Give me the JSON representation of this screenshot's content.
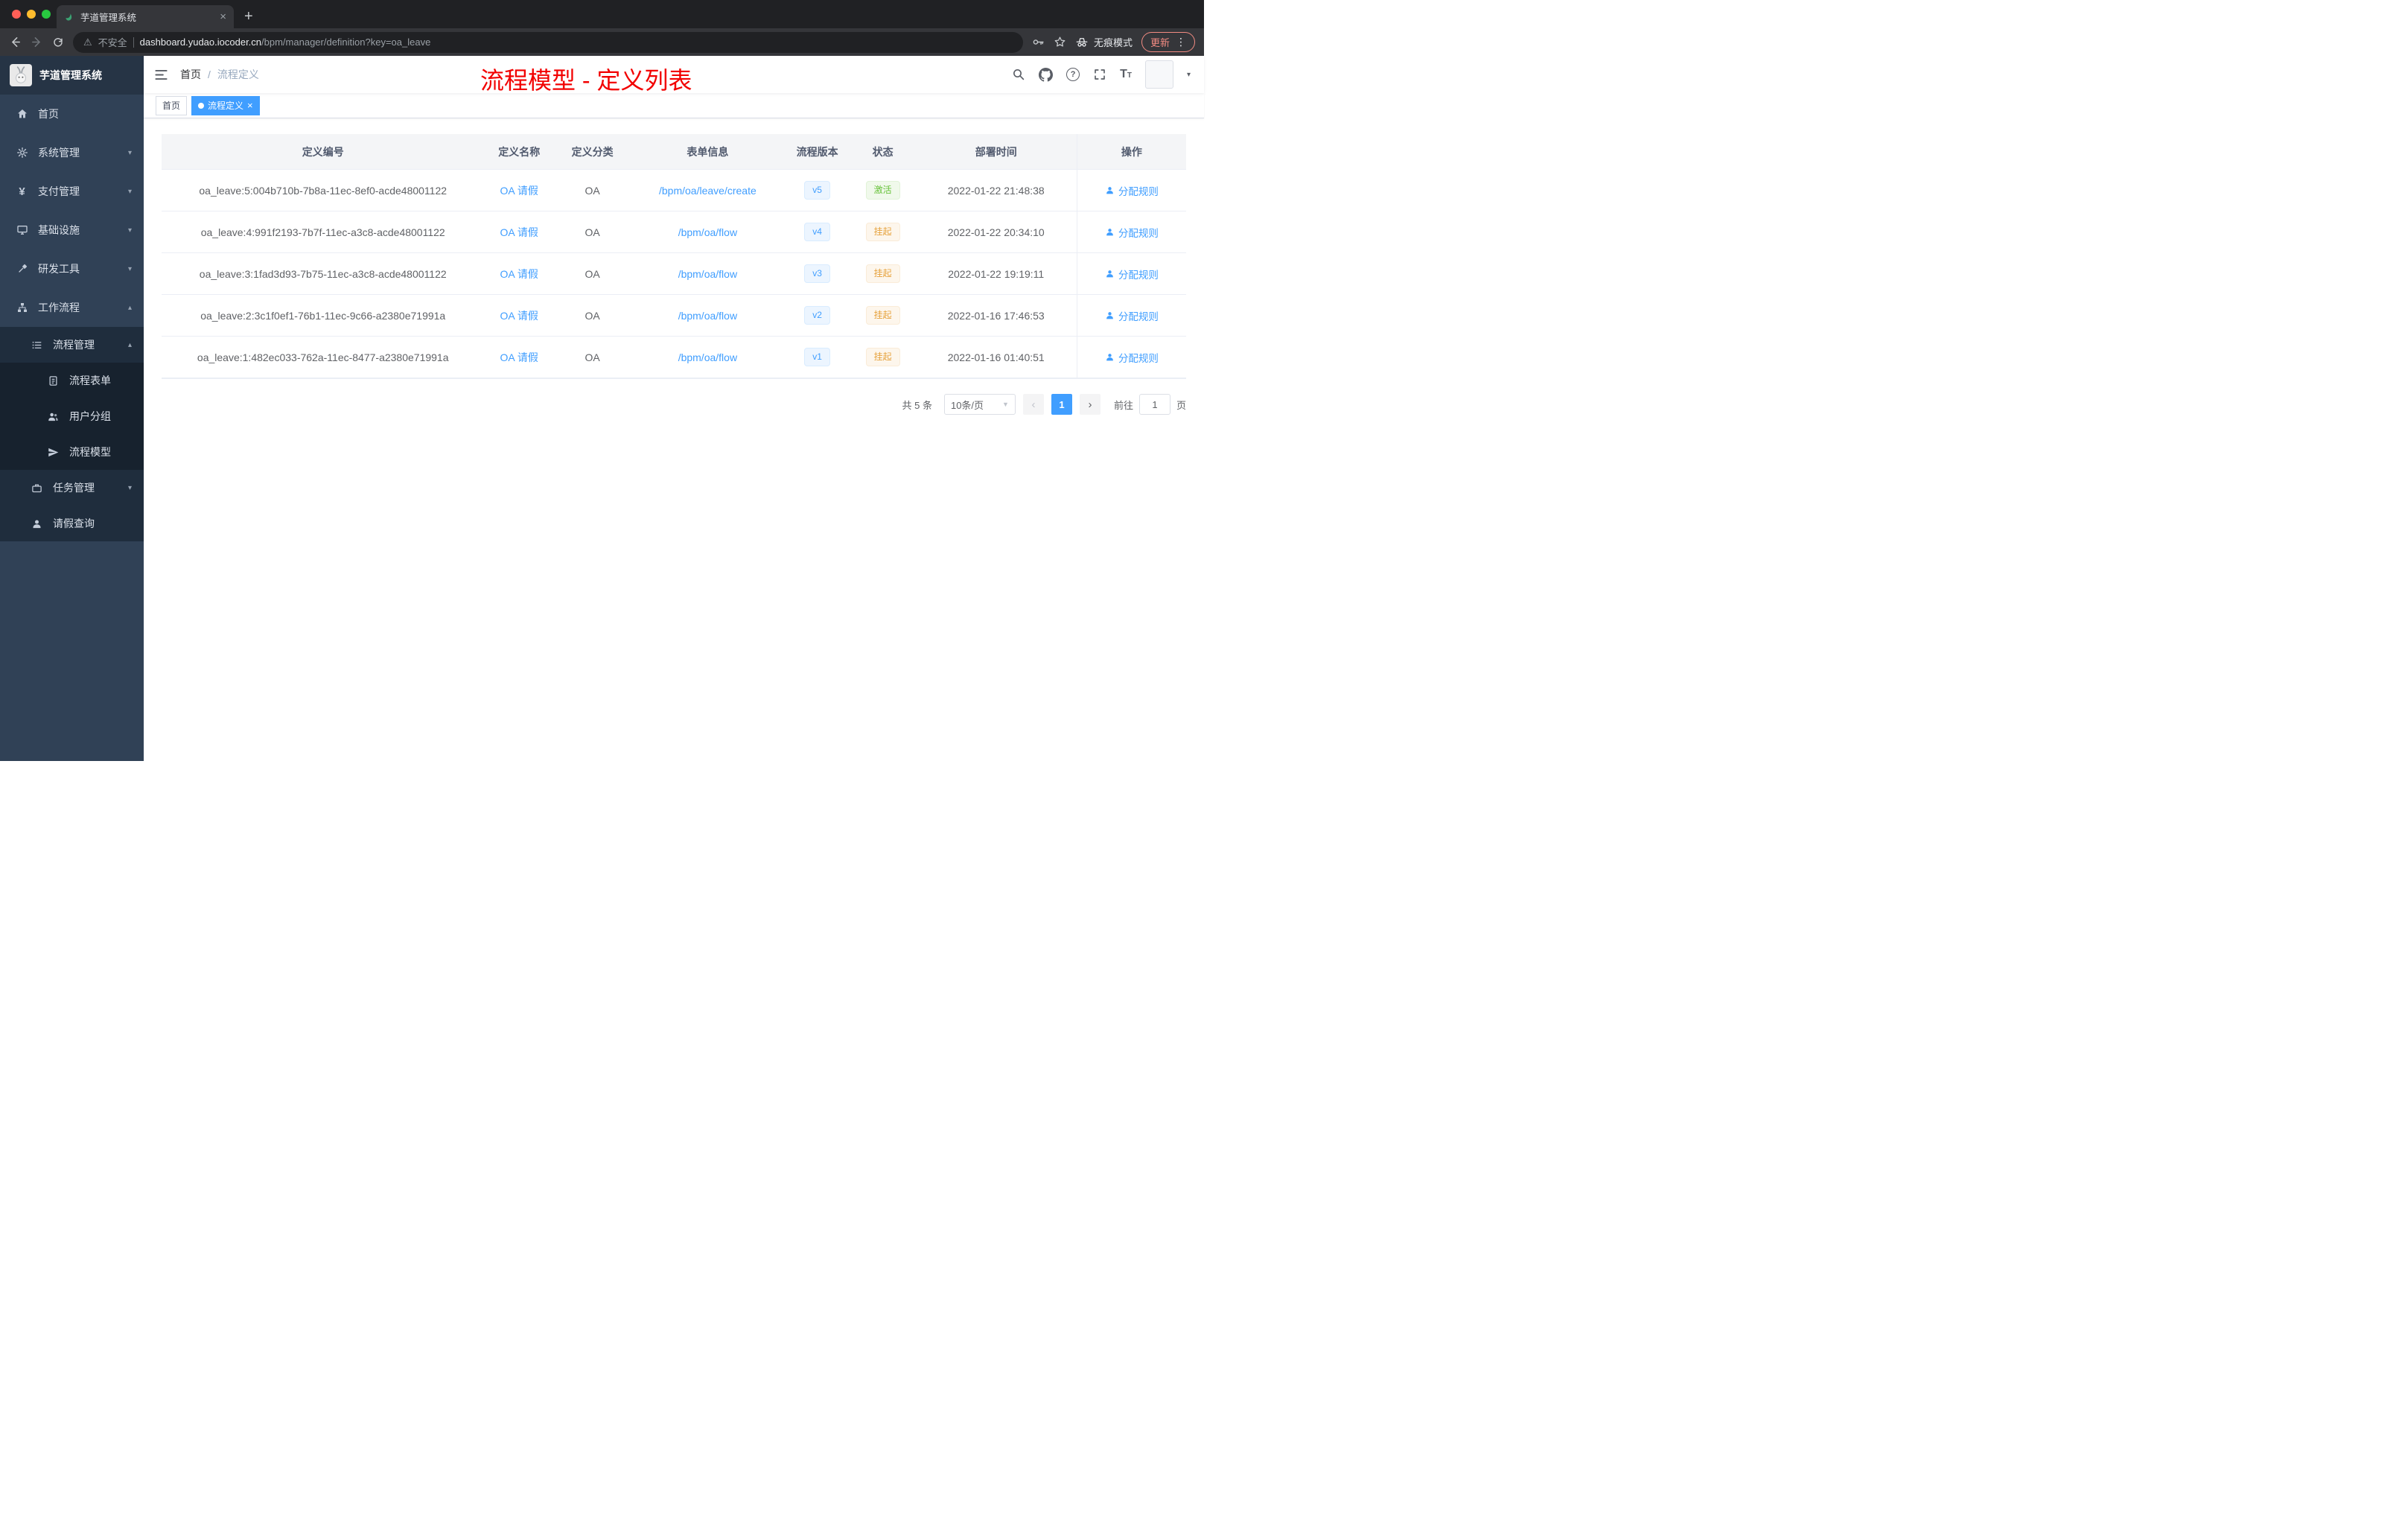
{
  "browser": {
    "tab_title": "芋道管理系统",
    "security": "不安全",
    "url_host": "dashboard.yudao.iocoder.cn",
    "url_path": "/bpm/manager/definition?key=oa_leave",
    "incognito": "无痕模式",
    "update": "更新"
  },
  "sidebar": {
    "brand": "芋道管理系统",
    "items": [
      {
        "label": "首页"
      },
      {
        "label": "系统管理"
      },
      {
        "label": "支付管理"
      },
      {
        "label": "基础设施"
      },
      {
        "label": "研发工具"
      },
      {
        "label": "工作流程"
      }
    ],
    "submenu": {
      "process_mgmt": "流程管理",
      "process_children": [
        {
          "label": "流程表单"
        },
        {
          "label": "用户分组"
        },
        {
          "label": "流程模型"
        }
      ],
      "task_mgmt": "任务管理",
      "leave_query": "请假查询"
    }
  },
  "header": {
    "breadcrumb_home": "首页",
    "breadcrumb_sep": "/",
    "breadcrumb_current": "流程定义",
    "annotation": "流程模型 - 定义列表"
  },
  "tags": {
    "home": "首页",
    "active": "流程定义"
  },
  "table": {
    "columns": {
      "id": "定义编号",
      "name": "定义名称",
      "category": "定义分类",
      "form": "表单信息",
      "version": "流程版本",
      "status": "状态",
      "deploy_time": "部署时间",
      "actions": "操作"
    },
    "action_label": "分配规则",
    "rows": [
      {
        "id": "oa_leave:5:004b710b-7b8a-11ec-8ef0-acde48001122",
        "name": "OA 请假",
        "category": "OA",
        "form": "/bpm/oa/leave/create",
        "version": "v5",
        "status": "激活",
        "time": "2022-01-22 21:48:38"
      },
      {
        "id": "oa_leave:4:991f2193-7b7f-11ec-a3c8-acde48001122",
        "name": "OA 请假",
        "category": "OA",
        "form": "/bpm/oa/flow",
        "version": "v4",
        "status": "挂起",
        "time": "2022-01-22 20:34:10"
      },
      {
        "id": "oa_leave:3:1fad3d93-7b75-11ec-a3c8-acde48001122",
        "name": "OA 请假",
        "category": "OA",
        "form": "/bpm/oa/flow",
        "version": "v3",
        "status": "挂起",
        "time": "2022-01-22 19:19:11"
      },
      {
        "id": "oa_leave:2:3c1f0ef1-76b1-11ec-9c66-a2380e71991a",
        "name": "OA 请假",
        "category": "OA",
        "form": "/bpm/oa/flow",
        "version": "v2",
        "status": "挂起",
        "time": "2022-01-16 17:46:53"
      },
      {
        "id": "oa_leave:1:482ec033-762a-11ec-8477-a2380e71991a",
        "name": "OA 请假",
        "category": "OA",
        "form": "/bpm/oa/flow",
        "version": "v1",
        "status": "挂起",
        "time": "2022-01-16 01:40:51"
      }
    ]
  },
  "pagination": {
    "total": "共 5 条",
    "page_size": "10条/页",
    "prev": "‹",
    "current": "1",
    "next": "›",
    "goto": "前往",
    "goto_value": "1",
    "unit": "页"
  },
  "colors": {
    "accent_blue": "#409eff",
    "success_green": "#67c23a",
    "warning_orange": "#e6a23c",
    "annotation_red": "#f20000",
    "sidebar_bg": "#304156"
  }
}
